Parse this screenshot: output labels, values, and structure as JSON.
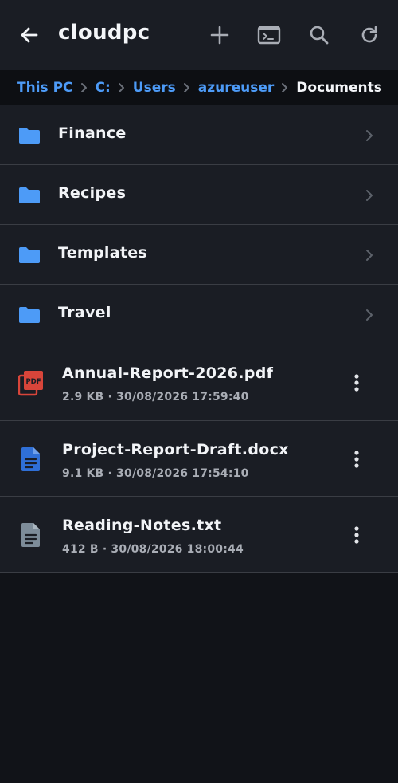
{
  "appbar": {
    "title": "cloudpc",
    "icons": [
      "arrow-back-icon",
      "plus-icon",
      "terminal-icon",
      "search-icon",
      "refresh-icon"
    ]
  },
  "breadcrumb": [
    "This PC",
    "C:",
    "Users",
    "azureuser",
    "Documents"
  ],
  "folders": [
    {
      "name": "Finance"
    },
    {
      "name": "Recipes"
    },
    {
      "name": "Templates"
    },
    {
      "name": "Travel"
    }
  ],
  "files": [
    {
      "name": "Annual-Report-2026.pdf",
      "meta": "2.9 KB · 30/08/2026 17:59:40",
      "icon": "pdf-icon",
      "badge": "PDF"
    },
    {
      "name": "Project-Report-Draft.docx",
      "meta": "9.1 KB · 30/08/2026 17:54:10",
      "icon": "document-icon"
    },
    {
      "name": "Reading-Notes.txt",
      "meta": "412 B · 30/08/2026 18:00:44",
      "icon": "text-file-icon"
    }
  ],
  "colors": {
    "accent": "#4d9bf7",
    "folder": "#4d9bf7",
    "pdf": "#d8453a",
    "docx": "#2f6fd6",
    "txt": "#7d8c99",
    "background": "#111318",
    "surface": "#1a1d24"
  }
}
